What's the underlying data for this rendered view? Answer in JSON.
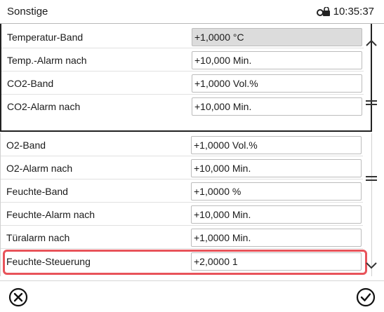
{
  "header": {
    "title": "Sonstige",
    "time": "10:35:37",
    "lock_icon": "lock-key-icon"
  },
  "section1": {
    "rows": [
      {
        "label": "Temperatur-Band",
        "value": "+1,0000 °C",
        "readonly": true
      },
      {
        "label": "Temp.-Alarm nach",
        "value": "+10,000 Min."
      },
      {
        "label": "CO2-Band",
        "value": "+1,0000 Vol.%"
      },
      {
        "label": "CO2-Alarm nach",
        "value": "+10,000 Min."
      }
    ]
  },
  "section2": {
    "rows": [
      {
        "label": "O2-Band",
        "value": "+1,0000 Vol.%"
      },
      {
        "label": "O2-Alarm nach",
        "value": "+10,000 Min."
      },
      {
        "label": "Feuchte-Band",
        "value": "+1,0000 %"
      },
      {
        "label": "Feuchte-Alarm nach",
        "value": "+10,000 Min."
      },
      {
        "label": "Türalarm nach",
        "value": "+1,0000 Min."
      },
      {
        "label": "Feuchte-Steuerung",
        "value": "+2,0000 1"
      }
    ]
  },
  "icons": {
    "scroll_up": "chevron-up-icon",
    "scroll_menu": "menu-lines-icon",
    "scroll_down": "chevron-down-icon",
    "cancel": "cancel-x-circle-icon",
    "confirm": "check-circle-icon"
  },
  "colors": {
    "highlight": "#e8535a",
    "readonly_field": "#dcdcdc"
  }
}
